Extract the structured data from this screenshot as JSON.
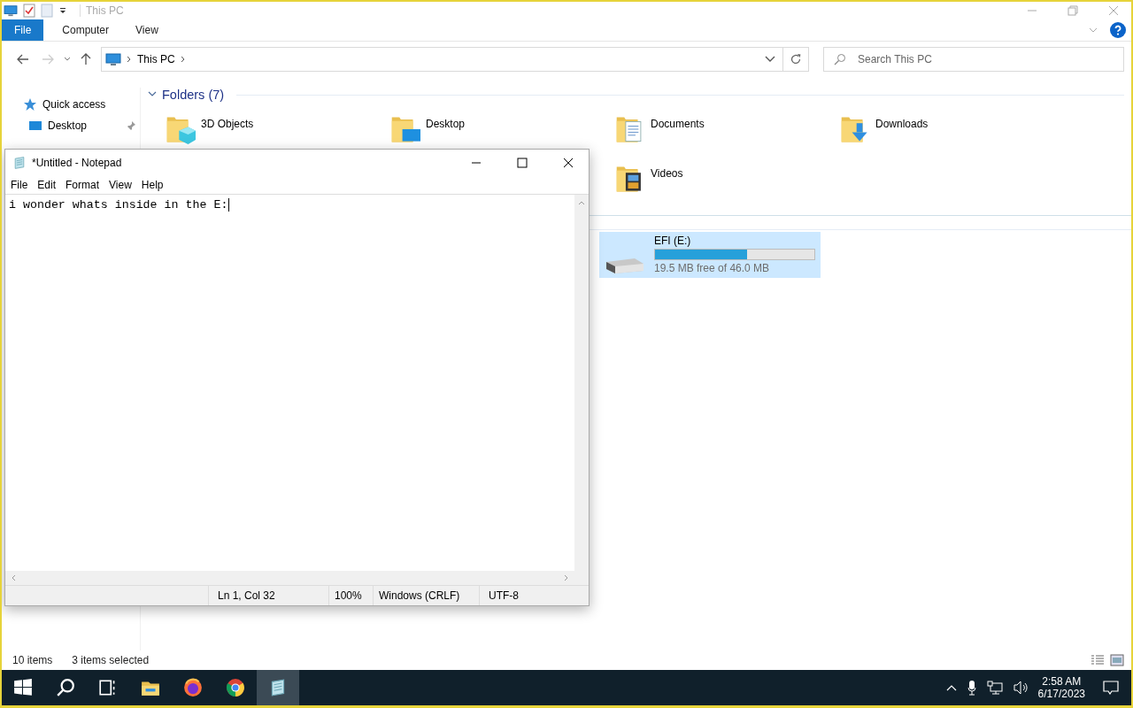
{
  "explorer": {
    "title": "This PC",
    "ribbon_tabs": [
      {
        "label": "File",
        "kind": "menu"
      },
      {
        "label": "Computer",
        "kind": "tab",
        "selected": false
      },
      {
        "label": "View",
        "kind": "tab",
        "selected": false
      }
    ],
    "address": {
      "path": [
        "This PC"
      ]
    },
    "search": {
      "placeholder": "Search This PC"
    },
    "sidebar": {
      "items": [
        {
          "label": "Quick access",
          "kind": "star",
          "pinned": false
        },
        {
          "label": "Desktop",
          "kind": "desktop",
          "pinned": true
        }
      ]
    },
    "folders": {
      "header": "Folders (7)",
      "items": [
        {
          "label": "3D Objects",
          "kind": "cube"
        },
        {
          "label": "Desktop",
          "kind": "desktop"
        },
        {
          "label": "Documents",
          "kind": "document"
        },
        {
          "label": "Downloads",
          "kind": "download"
        },
        {
          "label": "Videos",
          "kind": "film"
        }
      ]
    },
    "drives": [
      {
        "label": "EFI (E:)",
        "free": "19.5 MB free of 46.0 MB",
        "level": 0.58,
        "selected": true
      }
    ],
    "status_bar": {
      "count": "10 items",
      "selection": "3 items selected"
    }
  },
  "notepad": {
    "title": "*Untitled - Notepad",
    "menu": [
      "File",
      "Edit",
      "Format",
      "View",
      "Help"
    ],
    "text": "i wonder whats inside in the E:",
    "status": [
      "Ln 1, Col 32",
      "100%",
      "Windows (CRLF)",
      "UTF-8"
    ]
  },
  "taskbar": {
    "apps": [
      {
        "kind": "start",
        "active": false
      },
      {
        "kind": "search",
        "active": false
      },
      {
        "kind": "task-view",
        "active": false
      },
      {
        "kind": "explorer",
        "active": false
      },
      {
        "kind": "firefox",
        "active": false
      },
      {
        "kind": "chrome",
        "active": false
      },
      {
        "kind": "notepad",
        "active": true
      }
    ],
    "time": "2:58 AM",
    "date": "6/17/2023"
  }
}
